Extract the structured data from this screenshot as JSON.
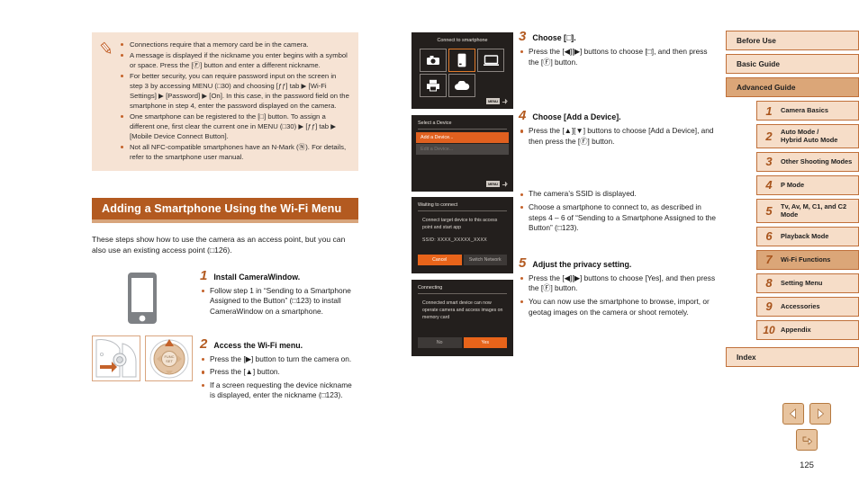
{
  "note": {
    "icon": "pencil-icon",
    "items": [
      "Connections require that a memory card be in the camera.",
      "A message is displayed if the nickname you enter begins with a symbol or space. Press the [Ⓕ] button and enter a different nickname.",
      "For better security, you can require password input on the screen in step 3 by accessing MENU (□30) and choosing [ƒƒ] tab ▶ [Wi-Fi Settings] ▶ [Password] ▶ [On]. In this case, in the password field on the smartphone in step 4, enter the password displayed on the camera.",
      "One smartphone can be registered to the [□] button. To assign a different one, first clear the current one in MENU (□30) ▶ [ƒƒ] tab ▶ [Mobile Device Connect Button].",
      "Not all NFC-compatible smartphones have an N-Mark (Ⓝ). For details, refer to the smartphone user manual."
    ]
  },
  "section": {
    "heading": "Adding a Smartphone Using the Wi-Fi Menu",
    "intro": "These steps show how to use the camera as an access point, but you can also use an existing access point (□126).",
    "heading_bg": "#b35a20",
    "heading_underbar": "#d8a57c"
  },
  "steps_left": [
    {
      "num": "1",
      "title": "Install CameraWindow.",
      "bullets": [
        "Follow step 1 in “Sending to a Smartphone Assigned to the Button” (□123) to install CameraWindow on a smartphone."
      ]
    },
    {
      "num": "2",
      "title": "Access the Wi-Fi menu.",
      "bullets": [
        "Press the [▶] button to turn the camera on.",
        "Press the [▲] button.",
        "If a screen requesting the device nickname is displayed, enter the nickname (□123)."
      ]
    }
  ],
  "steps_right": [
    {
      "num": "3",
      "title": "Choose [□].",
      "bullets": [
        "Press the [◀][▶] buttons to choose [□], and then press the [Ⓕ] button."
      ]
    },
    {
      "num": "4",
      "title": "Choose [Add a Device].",
      "bullets": [
        "Press the [▲][▼] buttons to choose [Add a Device], and then press the [Ⓕ] button."
      ]
    },
    {
      "num": "",
      "title": "",
      "bullets": [
        "The camera’s SSID is displayed.",
        "Choose a smartphone to connect to, as described in steps 4 – 6 of “Sending to a Smartphone Assigned to the Button” (□123)."
      ]
    },
    {
      "num": "5",
      "title": "Adjust the privacy setting.",
      "bullets": [
        "Press the [◀][▶] buttons to choose [Yes], and then press the [Ⓕ] button.",
        "You can now use the smartphone to browse, import, or geotag images on the camera or shoot remotely."
      ]
    }
  ],
  "camera_screens": [
    {
      "name": "connect-to-smartphone-screen",
      "title": "Connect to smartphone",
      "icons": [
        {
          "name": "camera-icon",
          "selected": false
        },
        {
          "name": "smartphone-icon",
          "selected": true
        },
        {
          "name": "computer-icon",
          "selected": false
        },
        {
          "name": "printer-icon",
          "selected": false
        },
        {
          "name": "cloud-icon",
          "selected": false
        }
      ],
      "menu_chip": "MENU"
    },
    {
      "name": "select-a-device-screen",
      "title": "Select a Device",
      "rows": [
        {
          "label": "Add a Device...",
          "state": "highlighted"
        },
        {
          "label": "Edit a Device...",
          "state": "disabled"
        }
      ],
      "menu_chip": "MENU"
    },
    {
      "name": "waiting-to-connect-screen",
      "title": "Waiting to connect",
      "message": "Connect target device to this access point and start app",
      "ssid": "SSID: XXXX_XXXXX_XXXX",
      "buttons": [
        {
          "label": "Cancel",
          "highlighted": true
        },
        {
          "label": "Switch Network",
          "highlighted": false
        }
      ]
    },
    {
      "name": "connecting-screen",
      "title": "Connecting",
      "message": "Connected smart device can now operate camera and access images on memory card",
      "buttons": [
        {
          "label": "No",
          "highlighted": false
        },
        {
          "label": "Yes",
          "highlighted": true
        }
      ]
    }
  ],
  "sidebar": {
    "top_items": [
      {
        "label": "Before Use",
        "active": false
      },
      {
        "label": "Basic Guide",
        "active": false
      },
      {
        "label": "Advanced Guide",
        "active": true
      }
    ],
    "chapters": [
      {
        "num": "1",
        "label": "Camera Basics",
        "active": false
      },
      {
        "num": "2",
        "label": "Auto Mode /\nHybrid Auto Mode",
        "active": false
      },
      {
        "num": "3",
        "label": "Other Shooting Modes",
        "active": false
      },
      {
        "num": "4",
        "label": "P Mode",
        "active": false
      },
      {
        "num": "5",
        "label": "Tv, Av, M, C1, and C2 Mode",
        "active": false
      },
      {
        "num": "6",
        "label": "Playback Mode",
        "active": false
      },
      {
        "num": "7",
        "label": "Wi-Fi Functions",
        "active": true
      },
      {
        "num": "8",
        "label": "Setting Menu",
        "active": false
      },
      {
        "num": "9",
        "label": "Accessories",
        "active": false
      },
      {
        "num": "10",
        "label": "Appendix",
        "active": false
      }
    ],
    "index_label": "Index",
    "colors": {
      "fill": "#f6ddc8",
      "active_fill": "#dba678",
      "border": "#c0703a",
      "number": "#a8541c"
    }
  },
  "footer": {
    "prev_icon": "chevron-left-icon",
    "next_icon": "chevron-right-icon",
    "back_icon": "return-arrow-icon",
    "page_number": "125"
  }
}
